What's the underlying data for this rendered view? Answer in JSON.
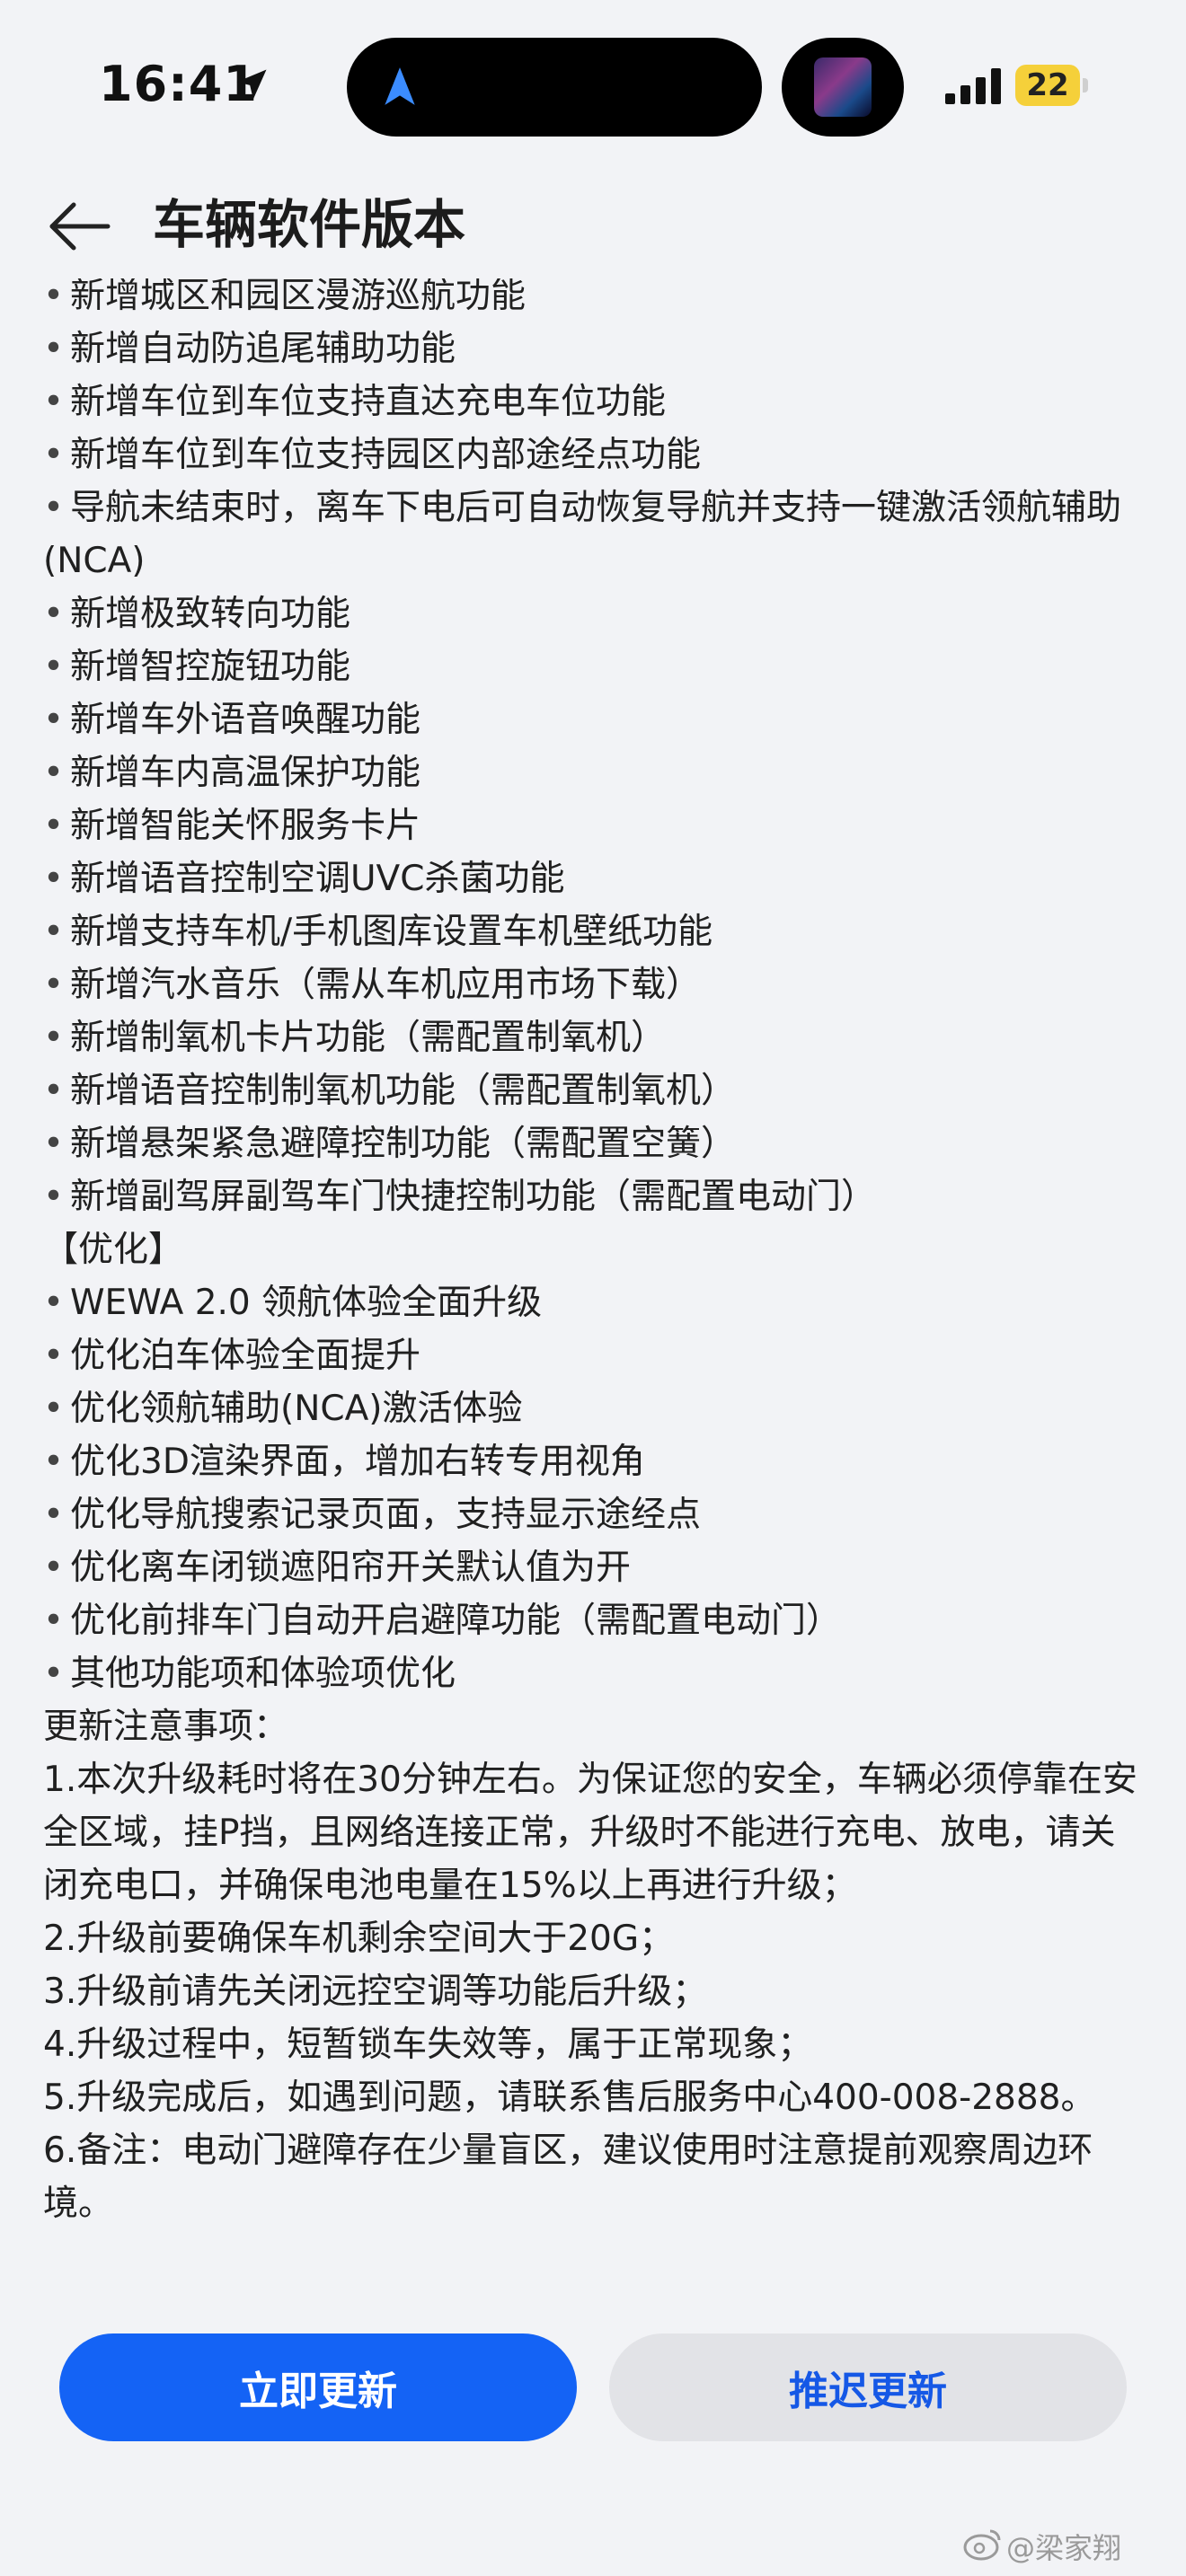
{
  "status_bar": {
    "time": "16:41",
    "battery": "22",
    "icons": [
      "location-arrow-icon",
      "navigation-icon",
      "app-thumbnail-icon",
      "signal-icon",
      "battery-icon"
    ]
  },
  "header": {
    "title": "车辆软件版本",
    "back_icon": "back-arrow-icon"
  },
  "content": {
    "new_items": [
      "新增城区和园区漫游巡航功能",
      "新增自动防追尾辅助功能",
      "新增车位到车位支持直达充电车位功能",
      "新增车位到车位支持园区内部途经点功能",
      "导航未结束时，离车下电后可自动恢复导航并支持一键激活领航辅助(NCA)",
      "新增极致转向功能",
      "新增智控旋钮功能",
      "新增车外语音唤醒功能",
      "新增车内高温保护功能",
      "新增智能关怀服务卡片",
      "新增语音控制空调UVC杀菌功能",
      "新增支持车机/手机图库设置车机壁纸功能",
      "新增汽水音乐（需从车机应用市场下载）",
      "新增制氧机卡片功能（需配置制氧机）",
      "新增语音控制制氧机功能（需配置制氧机）",
      "新增悬架紧急避障控制功能（需配置空簧）",
      "新增副驾屏副驾车门快捷控制功能（需配置电动门）"
    ],
    "optimize_heading": "【优化】",
    "optimize_items": [
      "WEWA 2.0 领航体验全面升级",
      "优化泊车体验全面提升",
      "优化领航辅助(NCA)激活体验",
      "优化3D渲染界面，增加右转专用视角",
      "优化导航搜索记录页面，支持显示途经点",
      "优化离车闭锁遮阳帘开关默认值为开",
      "优化前排车门自动开启避障功能（需配置电动门）",
      "其他功能项和体验项优化"
    ],
    "notes_title": "更新注意事项：",
    "notes": [
      "1.本次升级耗时将在30分钟左右。为保证您的安全，车辆必须停靠在安全区域，挂P挡，且网络连接正常，升级时不能进行充电、放电，请关闭充电口，并确保电池电量在15%以上再进行升级；",
      "2.升级前要确保车机剩余空间大于20G；",
      "3.升级前请先关闭远控空调等功能后升级；",
      "4.升级过程中，短暂锁车失效等，属于正常现象；",
      "5.升级完成后，如遇到问题，请联系售后服务中心400-008-2888。",
      "6.备注：电动门避障存在少量盲区，建议使用时注意提前观察周边环境。"
    ]
  },
  "actions": {
    "update_now": "立即更新",
    "postpone": "推迟更新"
  },
  "watermark": {
    "text": "@梁家翔",
    "icon": "weibo-icon"
  },
  "colors": {
    "background": "#f2f3f6",
    "primary": "#1463f5",
    "secondary_bg": "#e2e3e7",
    "secondary_text": "#1558e6",
    "battery": "#f5d03a"
  }
}
